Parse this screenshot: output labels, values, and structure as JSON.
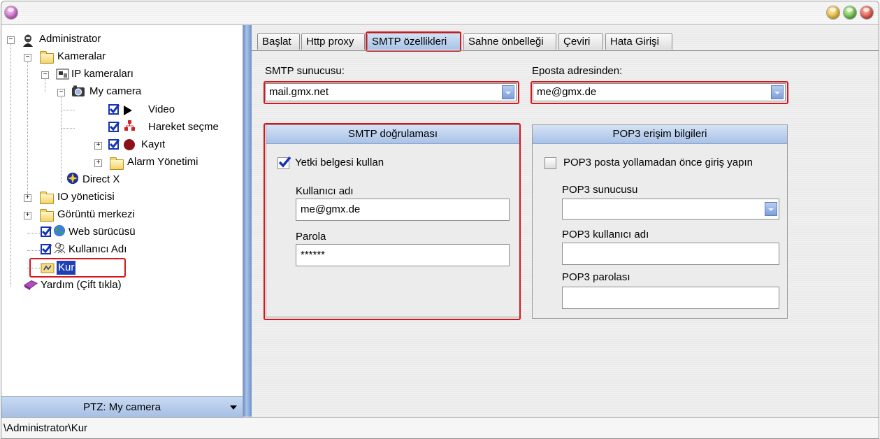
{
  "tree": {
    "nodes": {
      "administrator": "Administrator",
      "kameralar": "Kameralar",
      "ip_kameralari": "IP kameraları",
      "my_camera": "My camera",
      "video": "Video",
      "hareket": "Hareket seçme",
      "kayit": "Kayıt",
      "alarm": "Alarm Yönetimi",
      "directx": "Direct X",
      "io": "IO yöneticisi",
      "goruntu": "Görüntü merkezi",
      "web": "Web sürücüsü",
      "kullanici": "Kullanıcı Adı",
      "kur": "Kur",
      "yardim": "Yardım (Çift tıkla)"
    },
    "ptz_label": "PTZ: My camera"
  },
  "tabs": [
    "Başlat",
    "Http proxy",
    "SMTP özellikleri",
    "Sahne önbelleği",
    "Çeviri",
    "Hata Girişi"
  ],
  "smtp": {
    "server_label": "SMTP sunucusu:",
    "server_value": "mail.gmx.net",
    "from_label": "Eposta adresinden:",
    "from_value": "me@gmx.de",
    "auth": {
      "title": "SMTP doğrulaması",
      "use_credentials_label": "Yetki belgesi kullan",
      "use_credentials_checked": true,
      "username_label": "Kullanıcı adı",
      "username_value": "me@gmx.de",
      "password_label": "Parola",
      "password_value": "******"
    },
    "pop3": {
      "title": "POP3 erişim bilgileri",
      "login_before_label": "POP3 posta yollamadan önce giriş yapın",
      "login_before_checked": false,
      "server_label": "POP3 sunucusu",
      "server_value": "",
      "user_label": "POP3 kullanıcı adı",
      "user_value": "",
      "password_label": "POP3 parolası",
      "password_value": ""
    }
  },
  "statusbar": {
    "path": "\\Administrator\\Kur"
  },
  "colors": {
    "highlight_red": "#d8141c",
    "tab_active_blue": "#a9c3e6",
    "checkbox_blue": "#1333b6",
    "selected_item": "#1f3fb6"
  }
}
